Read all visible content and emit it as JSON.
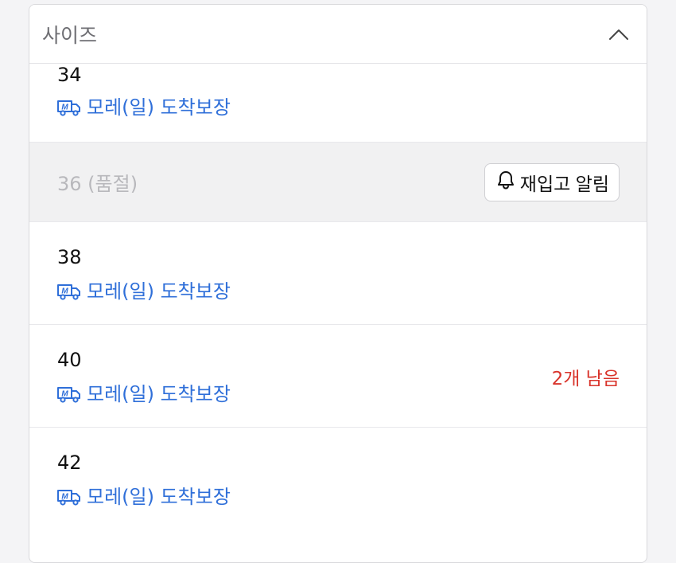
{
  "header": {
    "label": "사이즈",
    "toggle_icon": "chevron-up-icon"
  },
  "colors": {
    "delivery_blue": "#2f6fd9",
    "stock_red": "#d9342b",
    "soldout_gray": "#b8b8bc"
  },
  "options": [
    {
      "size": "34",
      "delivery": "모레(일) 도착보장"
    },
    {
      "soldout_label": "36 (품절)",
      "restock_label": "재입고 알림",
      "restock_icon": "bell-icon"
    },
    {
      "size": "38",
      "delivery": "모레(일) 도착보장"
    },
    {
      "size": "40",
      "delivery": "모레(일) 도착보장",
      "stock_note": "2개 남음"
    },
    {
      "size": "42",
      "delivery": "모레(일) 도착보장"
    }
  ]
}
